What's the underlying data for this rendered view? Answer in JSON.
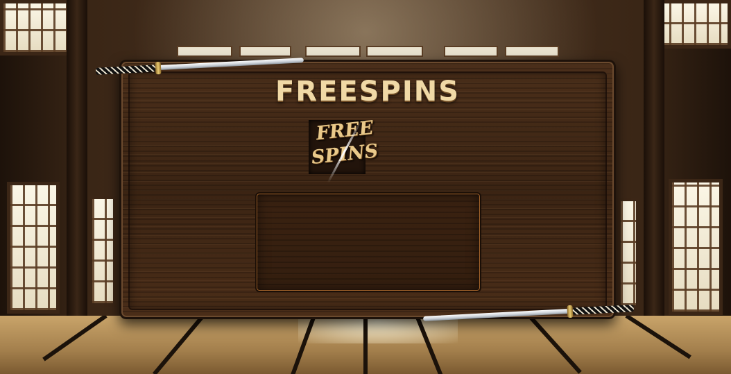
{
  "title": "FREESPINS",
  "symbol": {
    "line1": "FREE",
    "line2": "SPINS"
  },
  "message": "",
  "colors": {
    "title": "#f0d9a6",
    "panel_wood": "#3b2413",
    "message_border": "#a0622a"
  },
  "icons": [
    "katana-icon",
    "free-spins-symbol-icon"
  ]
}
